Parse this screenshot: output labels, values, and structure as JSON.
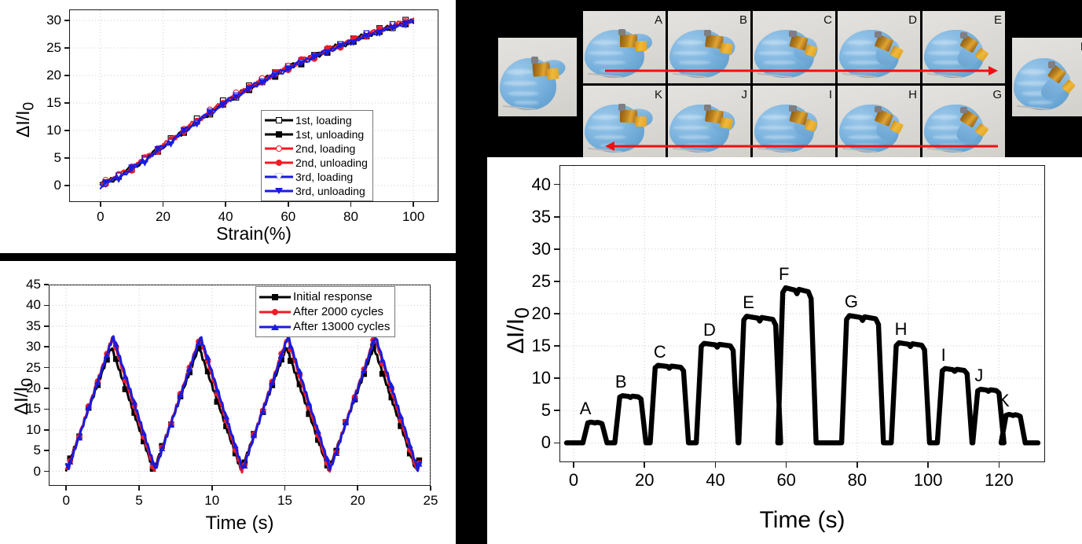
{
  "figure": {
    "background_color": "#000000",
    "panel_background": "#ffffff"
  },
  "colors": {
    "black": "#000000",
    "red": "#ee1c25",
    "blue": "#1b1bdd",
    "arrow_red": "#ee1111",
    "axis": "#1a1a1a",
    "grid": "#cccccc"
  },
  "panel_loading": {
    "name": "loading-unloading-chart",
    "chart_data": {
      "type": "line",
      "title": "",
      "xlabel": "Strain(%)",
      "ylabel": "ΔI/I₀",
      "xlim": [
        -10,
        108
      ],
      "ylim": [
        -3,
        32
      ],
      "xticks": [
        0,
        20,
        40,
        60,
        80,
        100
      ],
      "yticks": [
        0,
        5,
        10,
        15,
        20,
        25,
        30
      ],
      "grid": true,
      "legend_position": "center-right",
      "x": [
        0,
        5,
        10,
        15,
        20,
        25,
        30,
        35,
        40,
        45,
        50,
        55,
        60,
        65,
        70,
        75,
        80,
        85,
        90,
        95,
        100
      ],
      "series": [
        {
          "name": "1st, loading",
          "color": "#000000",
          "marker": "square-open",
          "values": [
            0.2,
            1.5,
            3.2,
            5.2,
            7.2,
            9.3,
            11.4,
            13.4,
            15.3,
            17.0,
            18.6,
            20.1,
            21.5,
            22.8,
            24.0,
            25.2,
            26.3,
            27.4,
            28.4,
            29.3,
            30.1
          ]
        },
        {
          "name": "1st, unloading",
          "color": "#000000",
          "marker": "square-filled",
          "values": [
            0.1,
            1.3,
            3.0,
            5.0,
            7.0,
            9.1,
            11.2,
            13.2,
            15.1,
            16.8,
            18.4,
            19.9,
            21.3,
            22.6,
            23.8,
            25.0,
            26.1,
            27.2,
            28.2,
            29.1,
            29.9
          ]
        },
        {
          "name": "2nd, loading",
          "color": "#ee1c25",
          "marker": "circle-open",
          "values": [
            0.3,
            1.6,
            3.3,
            5.3,
            7.3,
            9.4,
            11.5,
            13.5,
            15.4,
            17.1,
            18.7,
            20.2,
            21.6,
            22.9,
            24.1,
            25.3,
            26.4,
            27.5,
            28.5,
            29.4,
            30.2
          ]
        },
        {
          "name": "2nd, unloading",
          "color": "#ee1c25",
          "marker": "circle-filled",
          "values": [
            0.2,
            1.4,
            3.1,
            5.1,
            7.1,
            9.2,
            11.3,
            13.3,
            15.2,
            16.9,
            18.5,
            20.0,
            21.4,
            22.7,
            23.9,
            25.1,
            26.2,
            27.3,
            28.3,
            29.2,
            30.0
          ]
        },
        {
          "name": "3rd, loading",
          "color": "#1b1bdd",
          "marker": "triangle-down-open",
          "values": [
            0.0,
            1.4,
            3.1,
            5.1,
            7.1,
            9.2,
            11.3,
            13.3,
            15.2,
            16.9,
            18.5,
            20.0,
            21.4,
            22.7,
            23.9,
            25.1,
            26.2,
            27.3,
            28.3,
            29.2,
            30.0
          ]
        },
        {
          "name": "3rd, unloading",
          "color": "#1b1bdd",
          "marker": "triangle-down-filled",
          "values": [
            -0.1,
            1.2,
            2.9,
            4.9,
            6.9,
            9.0,
            11.1,
            13.1,
            15.0,
            16.7,
            18.3,
            19.8,
            21.2,
            22.5,
            23.7,
            24.9,
            26.0,
            27.1,
            28.1,
            29.0,
            29.8
          ]
        }
      ]
    }
  },
  "panel_cycles": {
    "name": "durability-cycles-chart",
    "chart_data": {
      "type": "line",
      "title": "",
      "xlabel": "Time (s)",
      "ylabel": "ΔI/I₀",
      "xlim": [
        -1.2,
        25
      ],
      "ylim": [
        -3.5,
        45
      ],
      "xticks": [
        0,
        5,
        10,
        15,
        20,
        25
      ],
      "yticks": [
        0,
        5,
        10,
        15,
        20,
        25,
        30,
        35,
        40,
        45
      ],
      "grid": true,
      "legend_position": "top-right",
      "period_s": 6,
      "cycles": 4,
      "peak_times": [
        3.1,
        9.1,
        15.1,
        21.1
      ],
      "trough_times": [
        0,
        6.1,
        12.2,
        18.2,
        24.2
      ],
      "series": [
        {
          "name": "Initial response",
          "color": "#000000",
          "marker": "square-filled",
          "peak_value": 30.0,
          "trough_value": 0.2
        },
        {
          "name": "After 2000 cycles",
          "color": "#ee1c25",
          "marker": "circle-filled",
          "peak_value": 32.3,
          "trough_value": 0.0
        },
        {
          "name": "After 13000 cycles",
          "color": "#1b1bdd",
          "marker": "triangle-up-filled",
          "peak_value": 32.5,
          "trough_value": 0.4
        }
      ]
    }
  },
  "panel_photos": {
    "name": "finger-bending-photo-strip",
    "reference_photo": {
      "label": "",
      "pose": "relaxed-hand-with-sensor"
    },
    "end_photo": {
      "label": "F",
      "pose": "full-fist"
    },
    "row_top": {
      "labels": [
        "A",
        "B",
        "C",
        "D",
        "E"
      ],
      "arrow_direction": "right",
      "arrow_name": "bending-direction-arrow-forward"
    },
    "row_bottom": {
      "labels": [
        "K",
        "J",
        "I",
        "H",
        "G"
      ],
      "arrow_direction": "left",
      "arrow_name": "bending-direction-arrow-reverse"
    }
  },
  "panel_finger": {
    "name": "finger-bending-response-chart",
    "chart_data": {
      "type": "line",
      "title": "",
      "xlabel": "Time (s)",
      "ylabel": "ΔI/I₀",
      "xlim": [
        -4,
        133
      ],
      "ylim": [
        -3,
        43
      ],
      "xticks": [
        0,
        20,
        40,
        60,
        80,
        100,
        120
      ],
      "yticks": [
        0,
        5,
        10,
        15,
        20,
        25,
        30,
        35,
        40
      ],
      "grid": true,
      "baseline": 0.0,
      "annotations": [
        "A",
        "B",
        "C",
        "D",
        "E",
        "F",
        "G",
        "H",
        "I",
        "J",
        "K"
      ],
      "peaks": [
        {
          "label": "A",
          "center_s": 6,
          "start_s": 4,
          "end_s": 8,
          "value": 3.2
        },
        {
          "label": "B",
          "center_s": 16,
          "start_s": 13,
          "end_s": 19,
          "value": 7.3
        },
        {
          "label": "C",
          "center_s": 27,
          "start_s": 23,
          "end_s": 31,
          "value": 12.0
        },
        {
          "label": "D",
          "center_s": 41,
          "start_s": 36,
          "end_s": 45,
          "value": 15.4
        },
        {
          "label": "E",
          "center_s": 52,
          "start_s": 48,
          "end_s": 57,
          "value": 19.6
        },
        {
          "label": "F",
          "center_s": 62,
          "start_s": 59,
          "end_s": 67,
          "value": 24.0
        },
        {
          "label": "G",
          "center_s": 81,
          "start_s": 77,
          "end_s": 86,
          "value": 19.7
        },
        {
          "label": "H",
          "center_s": 95,
          "start_s": 91,
          "end_s": 99,
          "value": 15.5
        },
        {
          "label": "I",
          "center_s": 107,
          "start_s": 104,
          "end_s": 111,
          "value": 11.5
        },
        {
          "label": "J",
          "center_s": 117,
          "start_s": 114,
          "end_s": 120,
          "value": 8.3
        },
        {
          "label": "K",
          "center_s": 124,
          "start_s": 122,
          "end_s": 126,
          "value": 4.4
        }
      ]
    }
  }
}
